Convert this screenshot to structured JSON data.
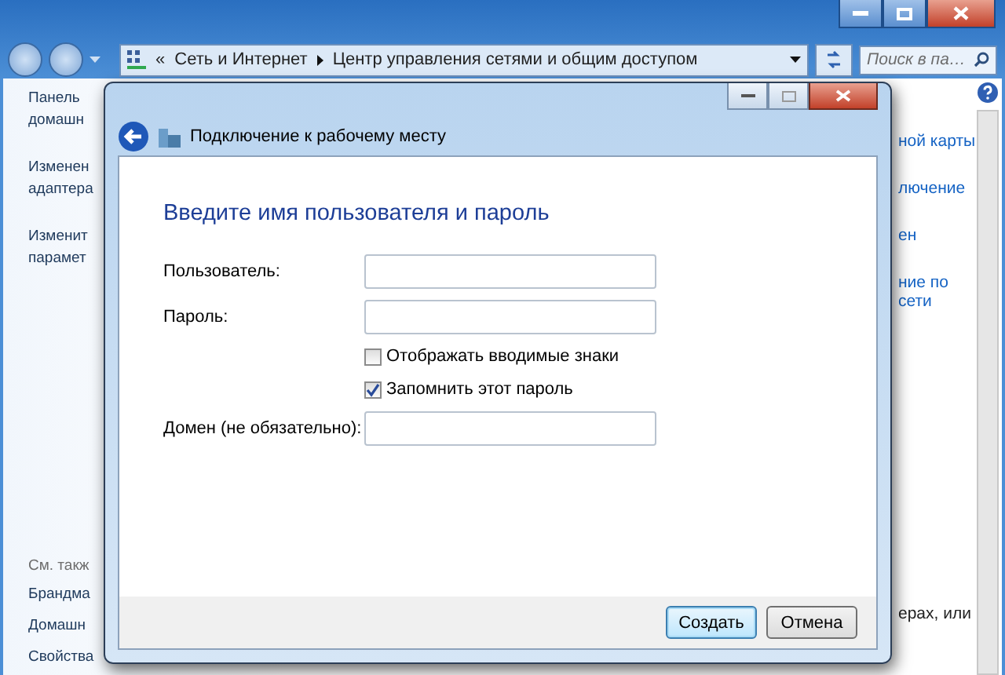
{
  "explorer": {
    "address": {
      "overflow": "«",
      "segments": [
        "Сеть и Интернет",
        "Центр управления сетями и общим доступом"
      ]
    },
    "search": {
      "placeholder": "Поиск в па…"
    },
    "sidebar": {
      "tasks": [
        {
          "lines": [
            "Панель",
            "домашн"
          ]
        },
        {
          "lines": [
            "Изменен",
            "адаптера"
          ]
        },
        {
          "lines": [
            "Изменит",
            "парамет"
          ]
        }
      ],
      "see_also_title": "См. такж",
      "see_also": [
        "Брандма",
        "Домашн",
        "Свойства"
      ]
    },
    "right_links": [
      {
        "lines": [
          "ной карты"
        ]
      },
      {
        "lines": [
          "лючение"
        ]
      },
      {
        "lines": [
          "ен"
        ]
      },
      {
        "lines": [
          "ние по",
          "сети"
        ]
      }
    ],
    "bottom_text": "ерах, или"
  },
  "dialog": {
    "title": "Подключение к рабочему месту",
    "heading": "Введите имя пользователя и пароль",
    "form": [
      {
        "kind": "text",
        "label": "Пользователь:"
      },
      {
        "kind": "password",
        "label": "Пароль:"
      },
      {
        "kind": "checkbox",
        "label": "Отображать вводимые знаки",
        "checked": false
      },
      {
        "kind": "checkbox",
        "label": "Запомнить этот пароль",
        "checked": true
      },
      {
        "kind": "text",
        "label": "Домен (не обязательно):"
      }
    ],
    "buttons": [
      {
        "label": "Создать",
        "default": true
      },
      {
        "label": "Отмена",
        "default": false
      }
    ]
  }
}
